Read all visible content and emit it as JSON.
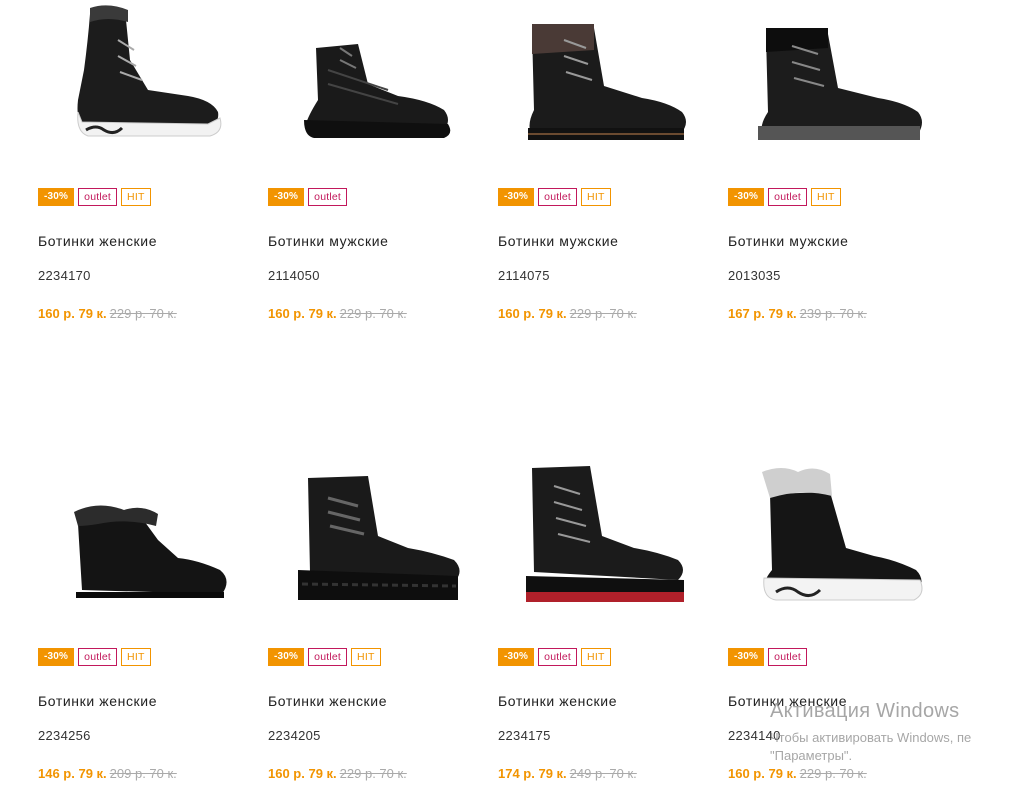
{
  "products": [
    {
      "name": "Ботинки женские",
      "sku": "2234170",
      "price_new": "160 р. 79 к.",
      "price_old": "229 р. 70 к.",
      "badges": {
        "sale": "-30%",
        "outlet": "outlet",
        "hit": "HIT"
      }
    },
    {
      "name": "Ботинки мужские",
      "sku": "2114050",
      "price_new": "160 р. 79 к.",
      "price_old": "229 р. 70 к.",
      "badges": {
        "sale": "-30%",
        "outlet": "outlet"
      }
    },
    {
      "name": "Ботинки мужские",
      "sku": "2114075",
      "price_new": "160 р. 79 к.",
      "price_old": "229 р. 70 к.",
      "badges": {
        "sale": "-30%",
        "outlet": "outlet",
        "hit": "HIT"
      }
    },
    {
      "name": "Ботинки мужские",
      "sku": "2013035",
      "price_new": "167 р. 79 к.",
      "price_old": "239 р. 70 к.",
      "badges": {
        "sale": "-30%",
        "outlet": "outlet",
        "hit": "HIT"
      }
    },
    {
      "name": "Ботинки женские",
      "sku": "2234256",
      "price_new": "146 р. 79 к.",
      "price_old": "209 р. 70 к.",
      "badges": {
        "sale": "-30%",
        "outlet": "outlet",
        "hit": "HIT"
      }
    },
    {
      "name": "Ботинки женские",
      "sku": "2234205",
      "price_new": "160 р. 79 к.",
      "price_old": "229 р. 70 к.",
      "badges": {
        "sale": "-30%",
        "outlet": "outlet",
        "hit": "HIT"
      }
    },
    {
      "name": "Ботинки женские",
      "sku": "2234175",
      "price_new": "174 р. 79 к.",
      "price_old": "249 р. 70 к.",
      "badges": {
        "sale": "-30%",
        "outlet": "outlet",
        "hit": "HIT"
      }
    },
    {
      "name": "Ботинки женские",
      "sku": "2234140",
      "price_new": "160 р. 79 к.",
      "price_old": "229 р. 70 к.",
      "badges": {
        "sale": "-30%",
        "outlet": "outlet"
      }
    }
  ],
  "watermark": {
    "title": "Активация Windows",
    "line1": "Чтобы активировать Windows, пе",
    "line2": "\"Параметры\"."
  },
  "colors": {
    "accent": "#f29400",
    "outlet": "#c2185b",
    "old_price": "#aaaaaa"
  }
}
